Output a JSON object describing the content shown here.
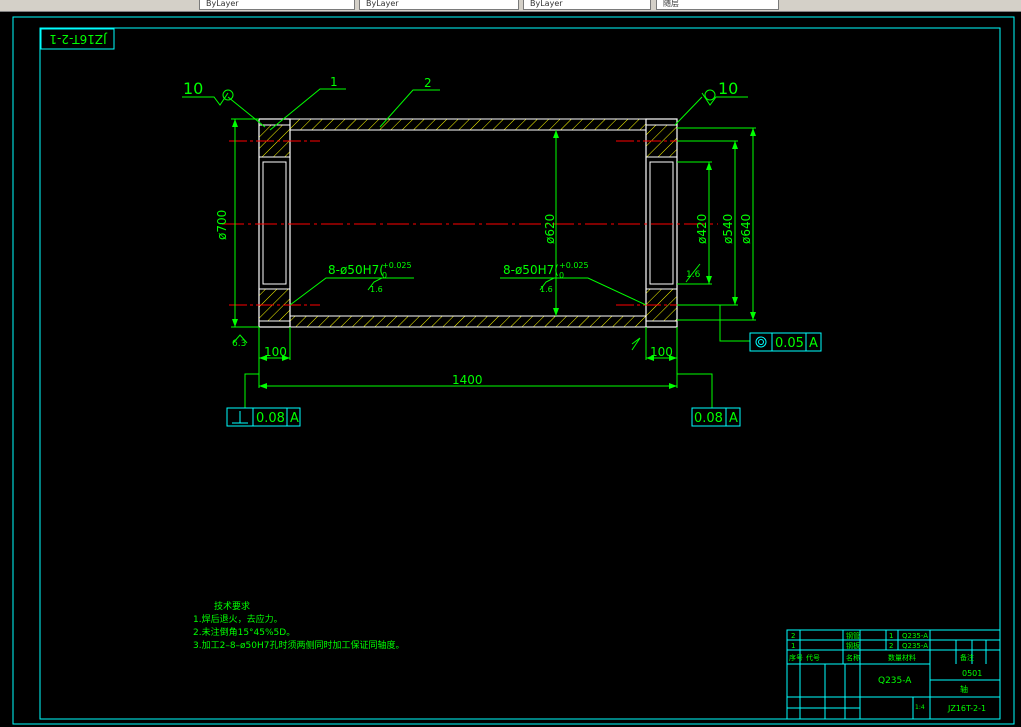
{
  "toolbar": {
    "items": [
      "ByLayer",
      "ByLayer",
      "ByLayer",
      "随层"
    ]
  },
  "drawing": {
    "drawing_code_rotated": "JZ16T-2-1",
    "roughness_left": "10",
    "roughness_right": "10",
    "part_callouts": [
      "1",
      "2"
    ],
    "dim_d700": "ø700",
    "dim_d620": "ø620",
    "dim_d420": "ø420",
    "dim_d540": "ø540",
    "dim_d640": "ø640",
    "holes_left": "8-ø50H7(",
    "holes_right": "8-ø50H7(",
    "tol_upper": "+0.025",
    "tol_lower": "0",
    "hole_finish_ra": "1.6",
    "ra_right_face": "1.6",
    "ra_63": "6.3",
    "dim_100_left": "100",
    "dim_100_right": "100",
    "dim_1400": "1400",
    "gtol_perp_value": "0.08",
    "gtol_perp_datum": "A",
    "gtol_par_value": "0.08",
    "gtol_par_datum": "A",
    "gtol_conc_value": "0.05",
    "gtol_conc_datum": "A",
    "tech_title": "技术要求",
    "tech_notes": [
      "1.焊后退火，去应力。",
      "2.未注倒角15°45%5D。",
      "3.加工2–8–ø50H7孔时须两侧同时加工保证同轴度。"
    ]
  },
  "title_block": {
    "rows": [
      {
        "no": "2",
        "name": "钢管",
        "qty": "1",
        "material": "Q235-A"
      },
      {
        "no": "1",
        "name": "钢板",
        "qty": "2",
        "material": "Q235-A"
      }
    ],
    "header_labels": [
      "序号",
      "代号",
      "名称",
      "数量",
      "材料",
      "备注"
    ],
    "material": "Q235-A",
    "company": "0501",
    "part_name": "轴",
    "drawing_no": "JZ16T-2-1",
    "scale": "1:4"
  },
  "colors": {
    "frame": "#00ffff",
    "outline": "#ffffff",
    "dimension": "#00ff00",
    "centerline": "#ff0000",
    "hatch": "#ffff00",
    "text": "#00ff00"
  }
}
